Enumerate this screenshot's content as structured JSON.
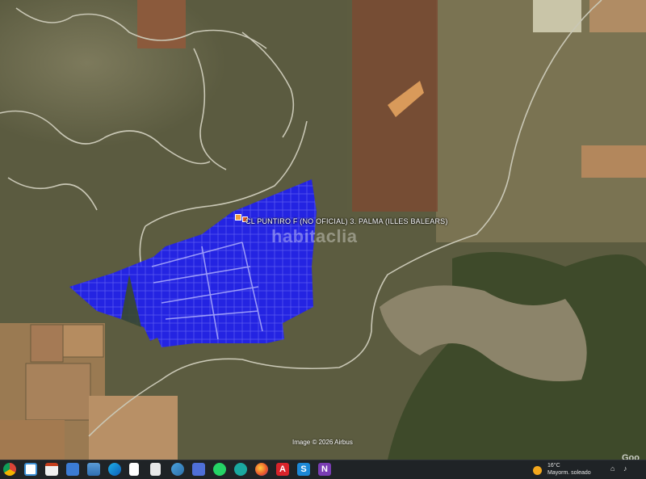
{
  "map": {
    "parcel_label": "CL PUNTIRO F (NO OFICIAL) 3. PALMA (ILLES BALEARS)",
    "watermark": "habitaclia",
    "imagery_credit": "Image © 2026 Airbus",
    "brand": "Goo",
    "overlay_color": "#1a1aff",
    "terrain_color": "#8a6e55"
  },
  "taskbar": {
    "icons": [
      "chrome-icon",
      "taskview-icon",
      "slides-icon",
      "store-icon",
      "photos-icon",
      "edge-icon",
      "document-icon",
      "file-icon",
      "browser-icon",
      "save-icon",
      "whatsapp-icon",
      "app-icon",
      "firefox-icon",
      "acrobat-icon",
      "skype-icon",
      "onenote-icon"
    ],
    "weather": {
      "temperature": "16°C",
      "condition": "Mayorm. soleado"
    }
  }
}
